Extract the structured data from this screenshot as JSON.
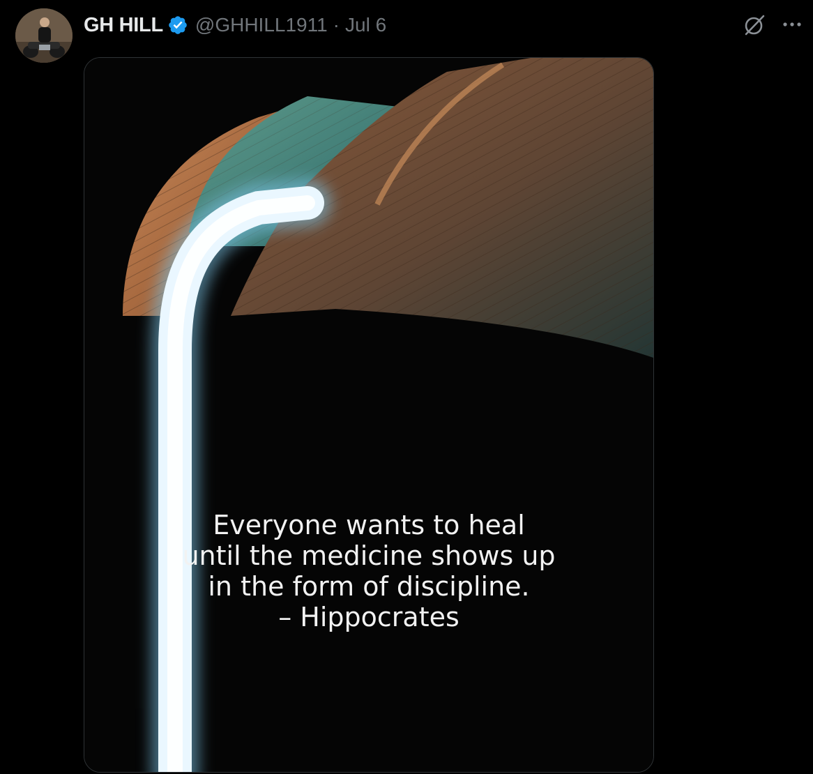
{
  "tweet": {
    "author": {
      "display_name": "GH HILL",
      "handle": "@GHHILL1911",
      "verified": true,
      "verified_icon": "verified-badge-icon",
      "avatar_alt": "avatar"
    },
    "separator": "·",
    "date": "Jul 6",
    "actions": {
      "grok_icon": "grok-icon",
      "more_icon": "more-icon"
    },
    "media": {
      "quote_lines": [
        "Everyone wants to heal",
        "until the medicine shows up",
        "in the form of discipline.",
        "– Hippocrates"
      ]
    }
  },
  "colors": {
    "background": "#000000",
    "text_primary": "#e7e9ea",
    "text_secondary": "#71767b",
    "verified_blue": "#1d9bf0",
    "border": "#2f3336"
  }
}
